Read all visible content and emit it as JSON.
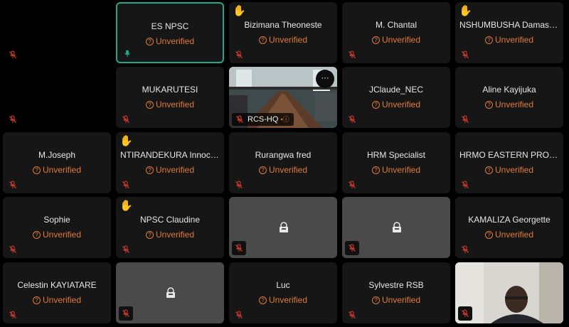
{
  "status_label": "Unverified",
  "colors": {
    "unverified": "#e07a3a",
    "active_border": "#1fa88c",
    "tile_bg": "#161616"
  },
  "participants": [
    {
      "name": ""
    },
    {
      "name": "ES NPSC",
      "status": "Unverified",
      "speaking": true
    },
    {
      "name": "Bizimana Theoneste",
      "status": "Unverified",
      "hand_raised": true
    },
    {
      "name": "M. Chantal",
      "status": "Unverified"
    },
    {
      "name": "NSHUMBUSHA Damasc...",
      "status": "Unverified",
      "hand_raised": true
    },
    {
      "name": ""
    },
    {
      "name": "MUKARUTESI",
      "status": "Unverified"
    },
    {
      "name": "RCS-HQ",
      "video": true
    },
    {
      "name": "JClaude_NEC",
      "status": "Unverified"
    },
    {
      "name": "Aline Kayijuka",
      "status": "Unverified"
    },
    {
      "name": "M.Joseph",
      "status": "Unverified"
    },
    {
      "name": "NTIRANDEKURA Innocent",
      "status": "Unverified",
      "hand_raised": true
    },
    {
      "name": "Rurangwa fred",
      "status": "Unverified"
    },
    {
      "name": "HRM Specialist",
      "status": "Unverified"
    },
    {
      "name": "HRMO EASTERN PROVI...",
      "status": "Unverified"
    },
    {
      "name": "Sophie",
      "status": "Unverified"
    },
    {
      "name": "NPSC Claudine",
      "status": "Unverified",
      "hand_raised": true
    },
    {
      "name": "",
      "camera_off": true
    },
    {
      "name": "",
      "camera_off": true
    },
    {
      "name": "KAMALIZA Georgette",
      "status": "Unverified"
    },
    {
      "name": "Celestin KAYIATARE",
      "status": "Unverified"
    },
    {
      "name": "",
      "camera_off": true
    },
    {
      "name": "Luc",
      "status": "Unverified"
    },
    {
      "name": "Sylvestre RSB",
      "status": "Unverified"
    },
    {
      "name": "",
      "video": true
    }
  ],
  "icons": {
    "mic_muted": "mic-muted-icon",
    "hand": "raised-hand-icon",
    "camera_off": "camera-off-icon",
    "more": "more-options-icon"
  }
}
